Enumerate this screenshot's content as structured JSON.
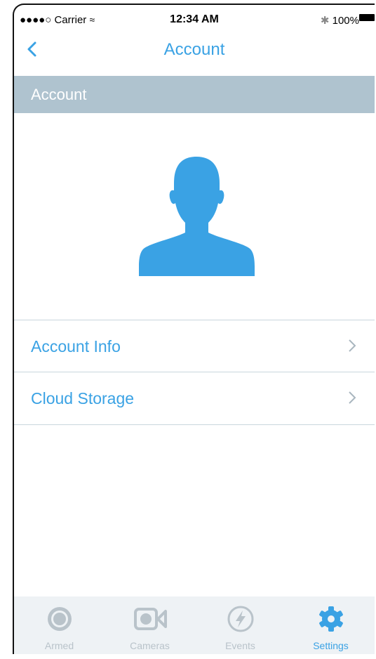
{
  "status_bar": {
    "carrier": "●●●●○ Carrier",
    "wifi": "ᯤ",
    "time": "12:34 AM",
    "bluetooth": "∦",
    "battery": "100%"
  },
  "nav": {
    "title": "Account",
    "back_icon": "chevron-left-icon"
  },
  "section": {
    "header": "Account"
  },
  "avatar": {
    "icon": "user-silhouette-icon",
    "color": "#3aa2e4"
  },
  "rows": [
    {
      "label": "Account Info",
      "icon": "chevron-right-icon"
    },
    {
      "label": "Cloud Storage",
      "icon": "chevron-right-icon"
    }
  ],
  "tabbar": {
    "tabs": [
      {
        "label": "Armed",
        "icon": "armed-icon",
        "active": false
      },
      {
        "label": "Cameras",
        "icon": "camera-icon",
        "active": false
      },
      {
        "label": "Events",
        "icon": "lightning-icon",
        "active": false
      },
      {
        "label": "Settings",
        "icon": "gear-icon",
        "active": true
      }
    ]
  },
  "colors": {
    "accent": "#3aa2e4",
    "header_bg": "#afc3cf",
    "inactive": "#b9c3ca",
    "tabbar_bg": "#eef2f5"
  }
}
